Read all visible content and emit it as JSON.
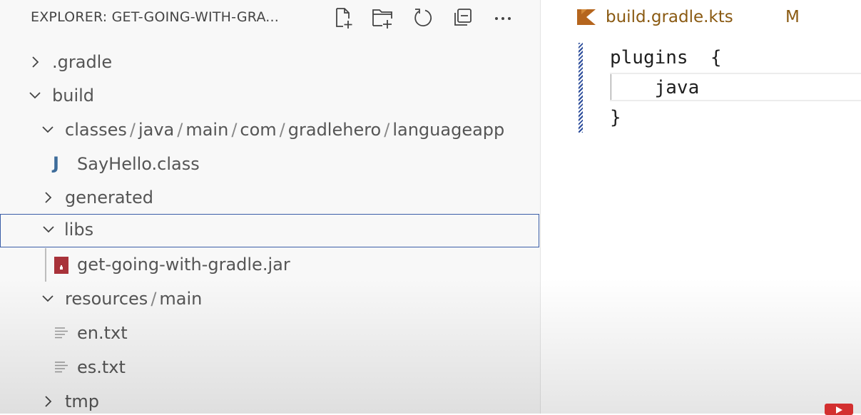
{
  "explorer": {
    "title": "EXPLORER: GET-GOING-WITH-GRA...",
    "actions": [
      {
        "name": "new-file-icon"
      },
      {
        "name": "new-folder-icon"
      },
      {
        "name": "refresh-icon"
      },
      {
        "name": "collapse-all-icon"
      },
      {
        "name": "more-actions-icon",
        "label": "···"
      }
    ],
    "tree": [
      {
        "label": ".gradle",
        "state": "collapsed",
        "kind": "folder"
      },
      {
        "label": "build",
        "state": "expanded",
        "kind": "folder"
      },
      {
        "path": [
          "classes",
          "java",
          "main",
          "com",
          "gradlehero",
          "languageapp"
        ],
        "separator": "/",
        "state": "expanded",
        "kind": "folder"
      },
      {
        "label": "SayHello.class",
        "kind": "file",
        "icon": "java-class-icon",
        "icon_glyph": "J"
      },
      {
        "label": "generated",
        "state": "collapsed",
        "kind": "folder"
      },
      {
        "label": "libs",
        "state": "expanded",
        "kind": "folder",
        "selected": true
      },
      {
        "label": "get-going-with-gradle.jar",
        "kind": "file",
        "icon": "jar-archive-icon"
      },
      {
        "path": [
          "resources",
          "main"
        ],
        "separator": "/",
        "state": "expanded",
        "kind": "folder"
      },
      {
        "label": "en.txt",
        "kind": "file",
        "icon": "text-file-icon"
      },
      {
        "label": "es.txt",
        "kind": "file",
        "icon": "text-file-icon"
      },
      {
        "label": "tmp",
        "state": "collapsed",
        "kind": "folder"
      }
    ]
  },
  "editor": {
    "file_name": "build.gradle.kts",
    "modified_badge": "M",
    "file_icon": "kotlin-icon",
    "code_lines": [
      "plugins  {",
      "    java",
      "}"
    ]
  },
  "colors": {
    "explorer_bg": "#f8f8f8",
    "selection_border": "#3b5ea8",
    "tab_text": "#8a5a12",
    "kotlin_icon": "#b5651d",
    "java_icon": "#3d6c9a",
    "jar_icon": "#a8323a",
    "gutter_modified": "#2b4c9a"
  }
}
